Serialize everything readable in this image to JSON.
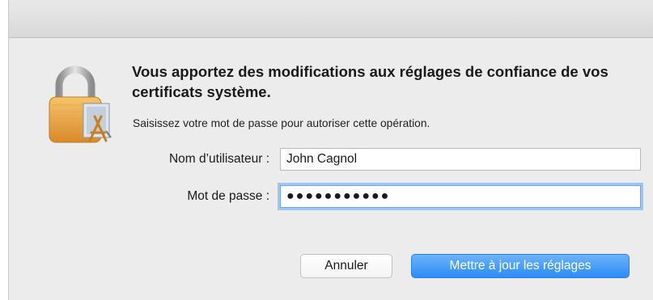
{
  "dialog": {
    "heading": "Vous apportez des modifications aux réglages de confiance de vos certificats système.",
    "subtext": "Saisissez votre mot de passe pour autoriser cette opération.",
    "username_label": "Nom d’utilisateur :",
    "username_value": "John Cagnol",
    "password_label": "Mot de passe :",
    "password_value": "●●●●●●●●●●●",
    "cancel_label": "Annuler",
    "confirm_label": "Mettre à jour les réglages"
  },
  "icons": {
    "lock": "lock-icon"
  },
  "colors": {
    "primary_button": "#2c8cf5",
    "focus_ring": "#9fc5f4",
    "lock_gold": "#e8a63a"
  }
}
